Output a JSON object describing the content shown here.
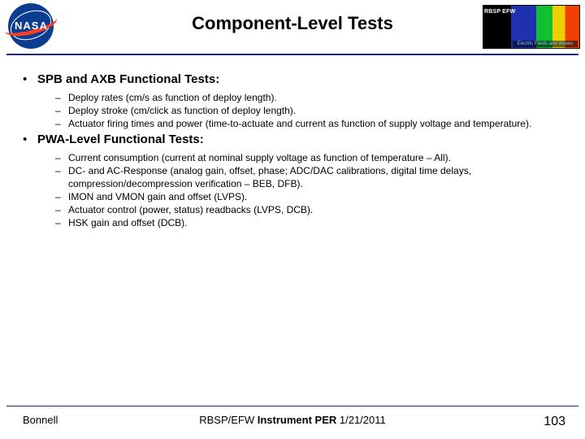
{
  "title": "Component-Level Tests",
  "logo_left_alt": "nasa-meatball",
  "logo_right": {
    "acronym": "RBSP\nEFW",
    "caption": "Electric Fields and Waves"
  },
  "sections": [
    {
      "heading": "SPB and AXB Functional Tests:",
      "items": [
        "Deploy rates (cm/s as function of deploy length).",
        "Deploy stroke (cm/click as function of deploy length).",
        "Actuator firing times and power (time-to-actuate and current as function of supply voltage and temperature)."
      ]
    },
    {
      "heading": "PWA-Level Functional Tests:",
      "items": [
        "Current consumption (current at nominal supply voltage as function of temperature – All).",
        "DC- and AC-Response (analog gain, offset, phase; ADC/DAC calibrations, digital time delays, compression/decompression verification – BEB, DFB).",
        "IMON and VMON gain and offset (LVPS).",
        "Actuator control (power, status) readbacks (LVPS, DCB).",
        "HSK gain and offset (DCB)."
      ]
    }
  ],
  "footer": {
    "author": "Bonnell",
    "center_prefix": "RBSP/EFW ",
    "center_bold": "Instrument PER",
    "center_suffix": " 1/21/2011",
    "page": "103"
  }
}
